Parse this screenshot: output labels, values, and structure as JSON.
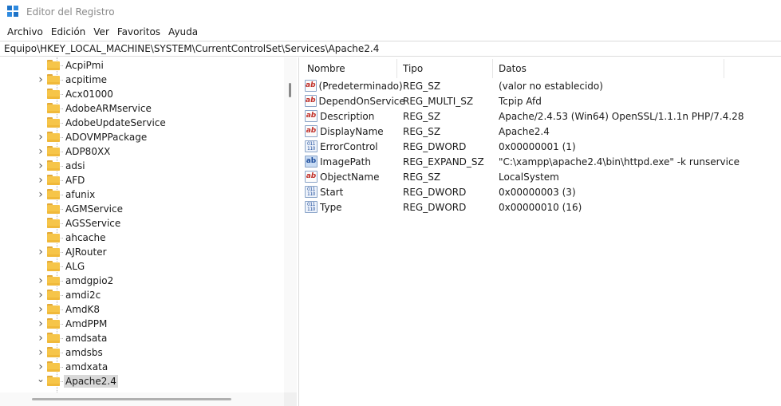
{
  "window": {
    "title": "Editor del Registro"
  },
  "menu": [
    "Archivo",
    "Edición",
    "Ver",
    "Favoritos",
    "Ayuda"
  ],
  "address": "Equipo\\HKEY_LOCAL_MACHINE\\SYSTEM\\CurrentControlSet\\Services\\Apache2.4",
  "tree": {
    "items": [
      {
        "label": "AcpiPmi",
        "expandable": false
      },
      {
        "label": "acpitime",
        "expandable": true
      },
      {
        "label": "Acx01000",
        "expandable": false
      },
      {
        "label": "AdobeARMservice",
        "expandable": false
      },
      {
        "label": "AdobeUpdateService",
        "expandable": false
      },
      {
        "label": "ADOVMPPackage",
        "expandable": true
      },
      {
        "label": "ADP80XX",
        "expandable": true
      },
      {
        "label": "adsi",
        "expandable": true
      },
      {
        "label": "AFD",
        "expandable": true
      },
      {
        "label": "afunix",
        "expandable": true
      },
      {
        "label": "AGMService",
        "expandable": false
      },
      {
        "label": "AGSService",
        "expandable": false
      },
      {
        "label": "ahcache",
        "expandable": false
      },
      {
        "label": "AJRouter",
        "expandable": true
      },
      {
        "label": "ALG",
        "expandable": false
      },
      {
        "label": "amdgpio2",
        "expandable": true
      },
      {
        "label": "amdi2c",
        "expandable": true
      },
      {
        "label": "AmdK8",
        "expandable": true
      },
      {
        "label": "AmdPPM",
        "expandable": true
      },
      {
        "label": "amdsata",
        "expandable": true
      },
      {
        "label": "amdsbs",
        "expandable": true
      },
      {
        "label": "amdxata",
        "expandable": true
      },
      {
        "label": "Apache2.4",
        "expandable": true,
        "expanded": true,
        "selected": true
      }
    ]
  },
  "list": {
    "headers": {
      "name": "Nombre",
      "type": "Tipo",
      "data": "Datos"
    },
    "rows": [
      {
        "icon": "string-value-icon",
        "name": "(Predeterminado)",
        "type": "REG_SZ",
        "data": "(valor no establecido)"
      },
      {
        "icon": "string-value-icon",
        "name": "DependOnService",
        "type": "REG_MULTI_SZ",
        "data": "Tcpip Afd"
      },
      {
        "icon": "string-value-icon",
        "name": "Description",
        "type": "REG_SZ",
        "data": "Apache/2.4.53 (Win64) OpenSSL/1.1.1n PHP/7.4.28"
      },
      {
        "icon": "string-value-icon",
        "name": "DisplayName",
        "type": "REG_SZ",
        "data": "Apache2.4"
      },
      {
        "icon": "binary-value-icon",
        "name": "ErrorControl",
        "type": "REG_DWORD",
        "data": "0x00000001 (1)"
      },
      {
        "icon": "expand-string-value-icon",
        "name": "ImagePath",
        "type": "REG_EXPAND_SZ",
        "data": "\"C:\\xampp\\apache2.4\\bin\\httpd.exe\" -k runservice"
      },
      {
        "icon": "string-value-icon",
        "name": "ObjectName",
        "type": "REG_SZ",
        "data": "LocalSystem"
      },
      {
        "icon": "binary-value-icon",
        "name": "Start",
        "type": "REG_DWORD",
        "data": "0x00000003 (3)"
      },
      {
        "icon": "binary-value-icon",
        "name": "Type",
        "type": "REG_DWORD",
        "data": "0x00000010 (16)"
      }
    ]
  },
  "icon_glyphs": {
    "string": "ab",
    "binary": "011\n110",
    "expand": "ab"
  },
  "colors": {
    "folder": "#f6c549",
    "selection": "#d9d9d9",
    "string_icon": "#c0312b"
  }
}
